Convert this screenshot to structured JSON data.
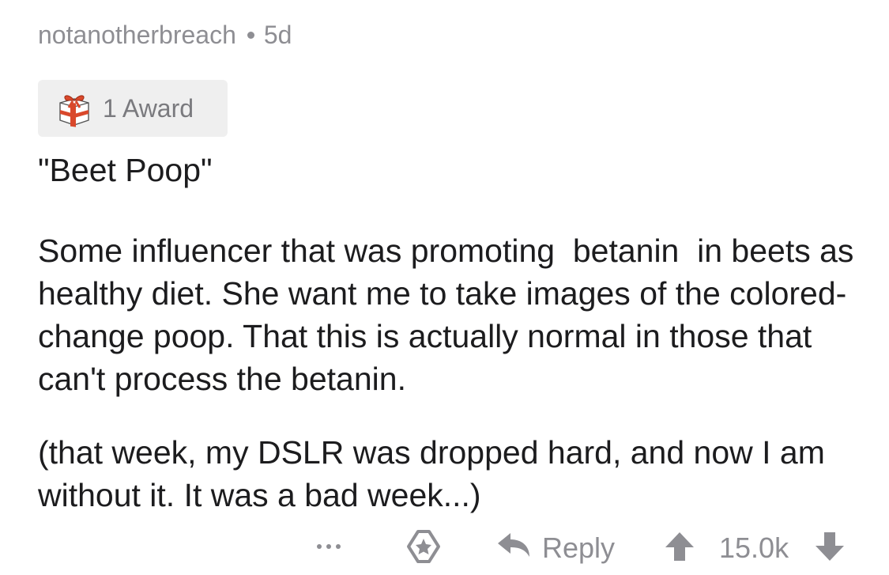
{
  "comment": {
    "author": "notanotherbreach",
    "age": "5d",
    "award_label": "1 Award",
    "title": "\"Beet Poop\"",
    "paragraphs": [
      "Some influencer that was promoting  betanin  in beets as healthy diet. She want me to take images of the colored-change poop. That this is actually normal in those that can't process the betanin.",
      "(that week, my DSLR was dropped hard, and now I am without it. It was a bad week...)"
    ]
  },
  "actions": {
    "more_icon": "ellipsis-icon",
    "award_icon": "award-icon",
    "reply_label": "Reply",
    "score": "15.0k"
  },
  "colors": {
    "text": "#1c1c1e",
    "muted": "#8e8e93",
    "pill_bg": "#efefef",
    "gift_red": "#d9482b"
  }
}
